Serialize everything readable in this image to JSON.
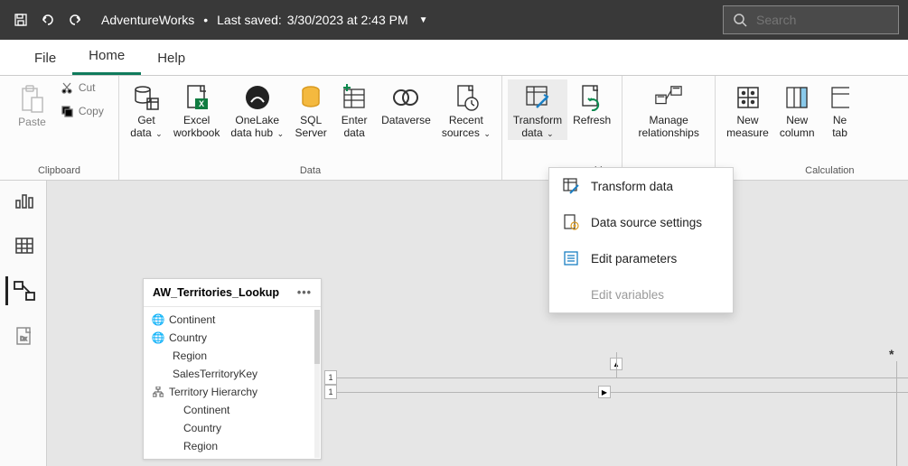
{
  "titlebar": {
    "filename": "AdventureWorks",
    "saved_prefix": "Last saved:",
    "saved_time": "3/30/2023 at 2:43 PM"
  },
  "search": {
    "placeholder": "Search"
  },
  "tabs": {
    "file": "File",
    "home": "Home",
    "help": "Help"
  },
  "ribbon": {
    "clipboard": {
      "paste": "Paste",
      "cut": "Cut",
      "copy": "Copy",
      "group": "Clipboard"
    },
    "data": {
      "getdata": "Get\ndata",
      "excel": "Excel\nworkbook",
      "onelake": "OneLake\ndata hub",
      "sql": "SQL\nServer",
      "enter": "Enter\ndata",
      "dataverse": "Dataverse",
      "recent": "Recent\nsources",
      "group": "Data"
    },
    "queries": {
      "transform": "Transform\ndata",
      "refresh": "Refresh",
      "group_partial": "hips"
    },
    "relationships": {
      "manage": "Manage\nrelationships"
    },
    "calc": {
      "measure": "New\nmeasure",
      "column": "New\ncolumn",
      "table_partial": "Ne\ntab",
      "group": "Calculation"
    }
  },
  "dropdown": {
    "transform": "Transform data",
    "dss": "Data source settings",
    "params": "Edit parameters",
    "vars": "Edit variables"
  },
  "tablecard": {
    "title": "AW_Territories_Lookup",
    "fields": {
      "continent": "Continent",
      "country": "Country",
      "region": "Region",
      "stkey": "SalesTerritoryKey",
      "hierarchy": "Territory Hierarchy",
      "h_continent": "Continent",
      "h_country": "Country",
      "h_region": "Region"
    }
  },
  "rel": {
    "one_a": "1",
    "one_b": "1",
    "many": "*"
  }
}
